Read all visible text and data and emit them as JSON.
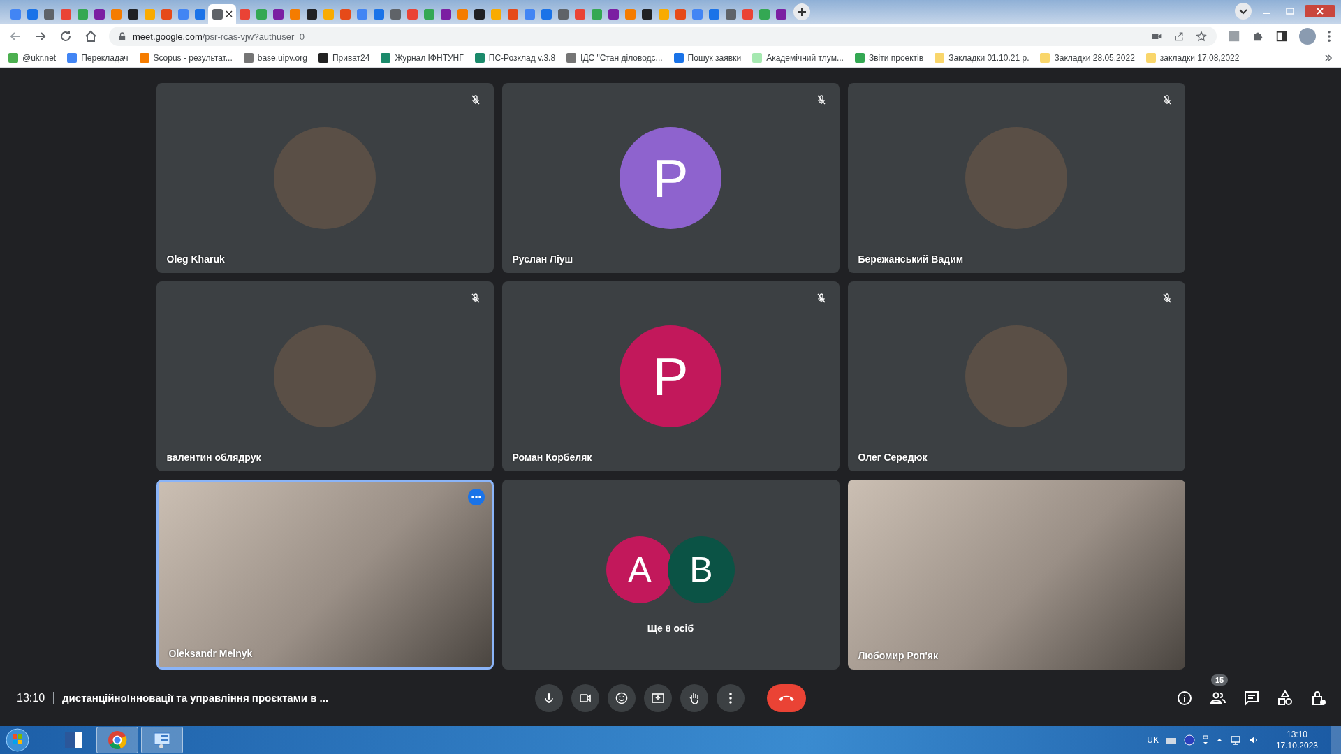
{
  "tabs": [
    {
      "selected": false
    },
    {
      "selected": false
    },
    {
      "selected": false
    },
    {
      "selected": false
    },
    {
      "selected": false
    },
    {
      "selected": false
    },
    {
      "selected": false
    },
    {
      "selected": false
    },
    {
      "selected": false
    },
    {
      "selected": false
    },
    {
      "selected": false
    },
    {
      "selected": false
    },
    {
      "selected": true
    },
    {
      "selected": false
    },
    {
      "selected": false
    },
    {
      "selected": false
    },
    {
      "selected": false
    },
    {
      "selected": false
    },
    {
      "selected": false
    },
    {
      "selected": false
    },
    {
      "selected": false
    },
    {
      "selected": false
    },
    {
      "selected": false
    },
    {
      "selected": false
    },
    {
      "selected": false
    },
    {
      "selected": false
    },
    {
      "selected": false
    },
    {
      "selected": false
    },
    {
      "selected": false
    },
    {
      "selected": false
    },
    {
      "selected": false
    },
    {
      "selected": false
    },
    {
      "selected": false
    },
    {
      "selected": false
    },
    {
      "selected": false
    },
    {
      "selected": false
    },
    {
      "selected": false
    },
    {
      "selected": false
    },
    {
      "selected": false
    },
    {
      "selected": false
    },
    {
      "selected": false
    },
    {
      "selected": false
    },
    {
      "selected": false
    },
    {
      "selected": false
    },
    {
      "selected": false
    },
    {
      "selected": false
    }
  ],
  "address_bar": {
    "host": "meet.google.com",
    "path": "/psr-rcas-vjw?authuser=0"
  },
  "bookmarks": [
    {
      "label": "@ukr.net",
      "color": "#4caf50"
    },
    {
      "label": "Перекладач",
      "color": "#4285f4"
    },
    {
      "label": "Scopus - результат...",
      "color": "#f57c00"
    },
    {
      "label": "base.uipv.org",
      "color": "#757575"
    },
    {
      "label": "Приват24",
      "color": "#222222"
    },
    {
      "label": "Журнал ІФНТУНГ",
      "color": "#1b8a6b"
    },
    {
      "label": "ПС-Розклад v.3.8",
      "color": "#1b8a6b"
    },
    {
      "label": "ІДС \"Стан діловодс...",
      "color": "#757575"
    },
    {
      "label": "Пошук заявки",
      "color": "#1a73e8"
    },
    {
      "label": "Академічний тлум...",
      "color": "#a5e8b0"
    },
    {
      "label": "Звіти проектів",
      "color": "#34a853"
    },
    {
      "label": "Закладки 01.10.21 р.",
      "color": "#f9d66b"
    },
    {
      "label": "Закладки 28.05.2022",
      "color": "#f9d66b"
    },
    {
      "label": "закладки 17,08,2022",
      "color": "#f9d66b"
    }
  ],
  "participants": [
    {
      "name": "Oleg Kharuk",
      "kind": "image",
      "muted": true,
      "selected": false
    },
    {
      "name": "Руслан Ліуш",
      "kind": "letter",
      "letter": "P",
      "color": "#8e63ce",
      "muted": true,
      "selected": false
    },
    {
      "name": "Бережанський Вадим",
      "kind": "image",
      "muted": true,
      "selected": false
    },
    {
      "name": "валентин облядрук",
      "kind": "image",
      "muted": true,
      "selected": false
    },
    {
      "name": "Роман Корбеляк",
      "kind": "letter",
      "letter": "P",
      "color": "#c2185b",
      "muted": true,
      "selected": false
    },
    {
      "name": "Олег Середюк",
      "kind": "image",
      "muted": true,
      "selected": false
    },
    {
      "name": "Oleksandr Melnyk",
      "kind": "video",
      "muted": false,
      "selected": true
    },
    {
      "kind": "more",
      "label": "Ще 8 осіб",
      "muted": false,
      "selected": false,
      "avatars": [
        {
          "letter": "A",
          "color": "#c2185b"
        },
        {
          "letter": "B",
          "color": "#0b5345"
        }
      ]
    },
    {
      "name": "Любомир Роп'як",
      "kind": "video",
      "muted": false,
      "selected": false
    }
  ],
  "meeting": {
    "time": "13:10",
    "title": "дистанційноІнновації та управління проєктами в ...",
    "people_count": "15"
  },
  "taskbar": {
    "language": "UK",
    "time": "13:10",
    "date": "17.10.2023"
  }
}
